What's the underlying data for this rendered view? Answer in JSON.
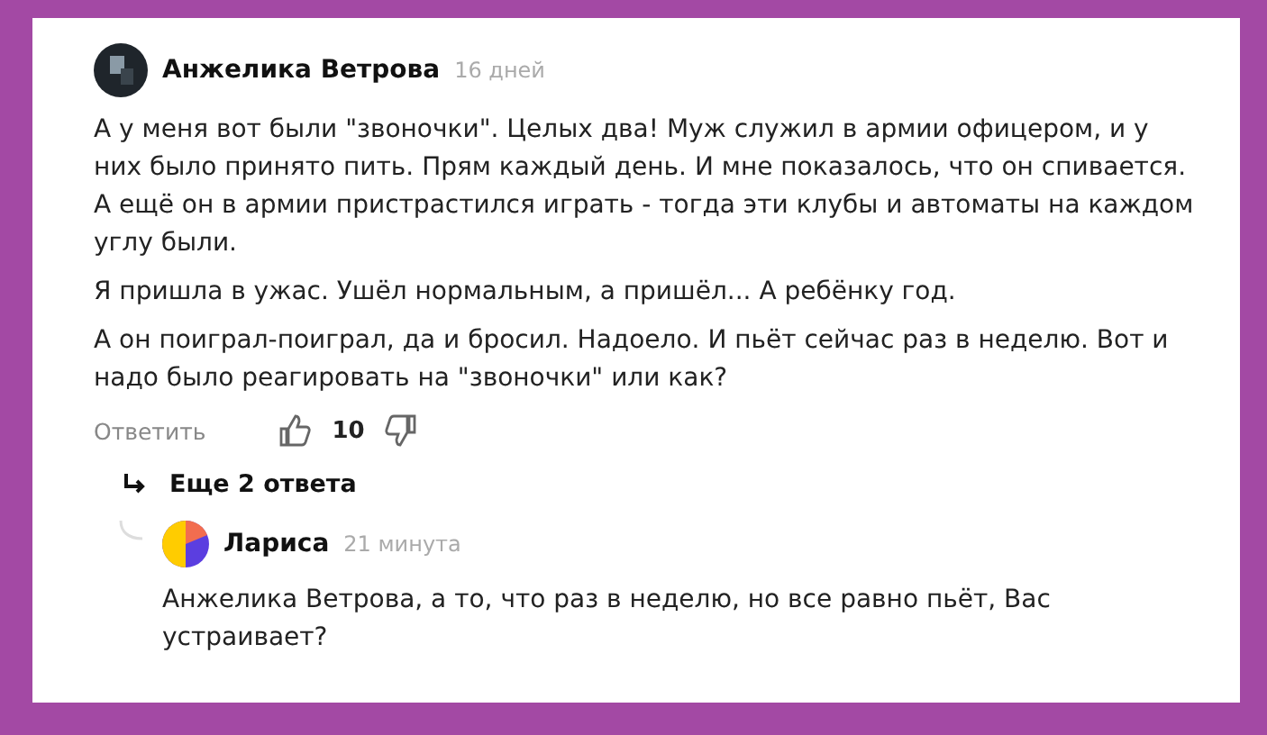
{
  "comment": {
    "author": "Анжелика Ветрова",
    "time": "16 дней",
    "paragraphs": [
      "А у меня вот были \"звоночки\". Целых два! Муж служил в армии офицером, и у них было принято пить. Прям каждый день. И мне показалось, что он спивается. А ещё он в армии пристрастился играть - тогда эти клубы и автоматы на каждом углу были.",
      "Я пришла в ужас. Ушёл нормальным, а пришёл... А ребёнку год.",
      "А он поиграл-поиграл, да и бросил. Надоело. И пьёт сейчас раз в неделю. Вот и надо было реагировать на \"звоночки\" или как?"
    ],
    "reply_label": "Ответить",
    "likes": "10",
    "more_replies": "Еще 2 ответа"
  },
  "reply": {
    "author": "Лариса",
    "time": "21 минута",
    "text": "Анжелика Ветрова, а то, что раз в неделю, но все равно пьёт, Вас устраивает?"
  }
}
